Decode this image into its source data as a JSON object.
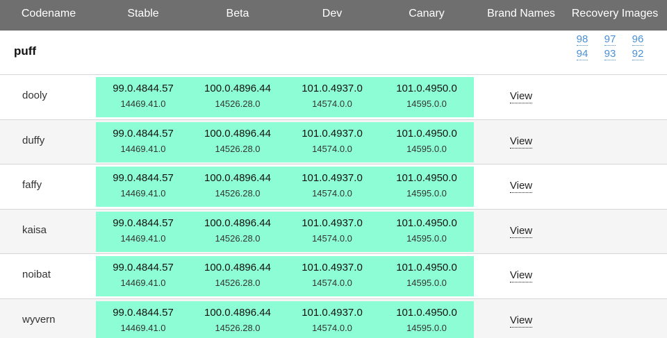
{
  "header": {
    "codename": "Codename",
    "stable": "Stable",
    "beta": "Beta",
    "dev": "Dev",
    "canary": "Canary",
    "brand_names": "Brand Names",
    "recovery_images": "Recovery Images"
  },
  "group": {
    "name": "puff",
    "recovery_images": [
      "98",
      "97",
      "96",
      "94",
      "93",
      "92"
    ]
  },
  "rows": [
    {
      "codename": "dooly",
      "stable": {
        "version": "99.0.4844.57",
        "platform": "14469.41.0"
      },
      "beta": {
        "version": "100.0.4896.44",
        "platform": "14526.28.0"
      },
      "dev": {
        "version": "101.0.4937.0",
        "platform": "14574.0.0"
      },
      "canary": {
        "version": "101.0.4950.0",
        "platform": "14595.0.0"
      },
      "brand_link": "View"
    },
    {
      "codename": "duffy",
      "stable": {
        "version": "99.0.4844.57",
        "platform": "14469.41.0"
      },
      "beta": {
        "version": "100.0.4896.44",
        "platform": "14526.28.0"
      },
      "dev": {
        "version": "101.0.4937.0",
        "platform": "14574.0.0"
      },
      "canary": {
        "version": "101.0.4950.0",
        "platform": "14595.0.0"
      },
      "brand_link": "View"
    },
    {
      "codename": "faffy",
      "stable": {
        "version": "99.0.4844.57",
        "platform": "14469.41.0"
      },
      "beta": {
        "version": "100.0.4896.44",
        "platform": "14526.28.0"
      },
      "dev": {
        "version": "101.0.4937.0",
        "platform": "14574.0.0"
      },
      "canary": {
        "version": "101.0.4950.0",
        "platform": "14595.0.0"
      },
      "brand_link": "View"
    },
    {
      "codename": "kaisa",
      "stable": {
        "version": "99.0.4844.57",
        "platform": "14469.41.0"
      },
      "beta": {
        "version": "100.0.4896.44",
        "platform": "14526.28.0"
      },
      "dev": {
        "version": "101.0.4937.0",
        "platform": "14574.0.0"
      },
      "canary": {
        "version": "101.0.4950.0",
        "platform": "14595.0.0"
      },
      "brand_link": "View"
    },
    {
      "codename": "noibat",
      "stable": {
        "version": "99.0.4844.57",
        "platform": "14469.41.0"
      },
      "beta": {
        "version": "100.0.4896.44",
        "platform": "14526.28.0"
      },
      "dev": {
        "version": "101.0.4937.0",
        "platform": "14574.0.0"
      },
      "canary": {
        "version": "101.0.4950.0",
        "platform": "14595.0.0"
      },
      "brand_link": "View"
    },
    {
      "codename": "wyvern",
      "stable": {
        "version": "99.0.4844.57",
        "platform": "14469.41.0"
      },
      "beta": {
        "version": "100.0.4896.44",
        "platform": "14526.28.0"
      },
      "dev": {
        "version": "101.0.4937.0",
        "platform": "14574.0.0"
      },
      "canary": {
        "version": "101.0.4950.0",
        "platform": "14595.0.0"
      },
      "brand_link": "View"
    }
  ],
  "colors": {
    "header_bg": "#6f6f6f",
    "channel_highlight": "#8dfdd6",
    "link": "#4a8fd6",
    "alt_row": "#f5f5f5"
  }
}
